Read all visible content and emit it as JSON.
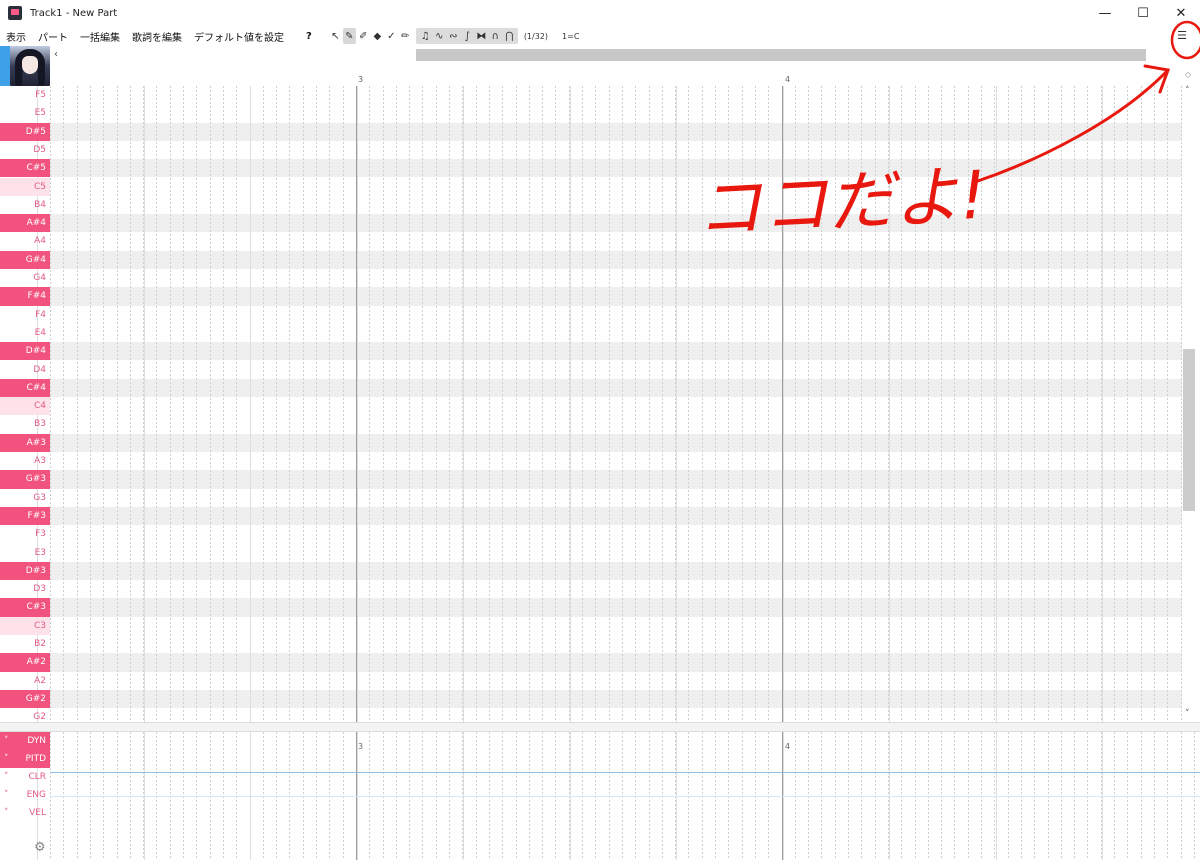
{
  "window": {
    "title": "Track1 - New Part",
    "controls": [
      "—",
      "☐",
      "✕"
    ]
  },
  "menu": {
    "items": [
      "表示",
      "パート",
      "一括編集",
      "歌詞を編集",
      "デフォルト値を設定",
      "?"
    ]
  },
  "toolbar": {
    "snap": "(1/32)",
    "key": "1=C"
  },
  "ruler": {
    "bars": [
      "3",
      "4"
    ]
  },
  "keys": [
    "F5",
    "E5",
    "D#5",
    "D5",
    "C#5",
    "C5",
    "B4",
    "A#4",
    "A4",
    "G#4",
    "G4",
    "F#4",
    "F4",
    "E4",
    "D#4",
    "D4",
    "C#4",
    "C4",
    "B3",
    "A#3",
    "A3",
    "G#3",
    "G3",
    "F#3",
    "F3",
    "E3",
    "D#3",
    "D3",
    "C#3",
    "C3",
    "B2",
    "A#2",
    "A2",
    "G#2",
    "G2"
  ],
  "curves": {
    "labels": [
      "DYN",
      "PITD",
      "CLR",
      "ENG",
      "VEL"
    ],
    "active": [
      "DYN",
      "PITD"
    ]
  },
  "annotation": {
    "text": "ココだよ!"
  },
  "colors": {
    "accent": "#f1527e",
    "annotation": "#e8180e"
  }
}
